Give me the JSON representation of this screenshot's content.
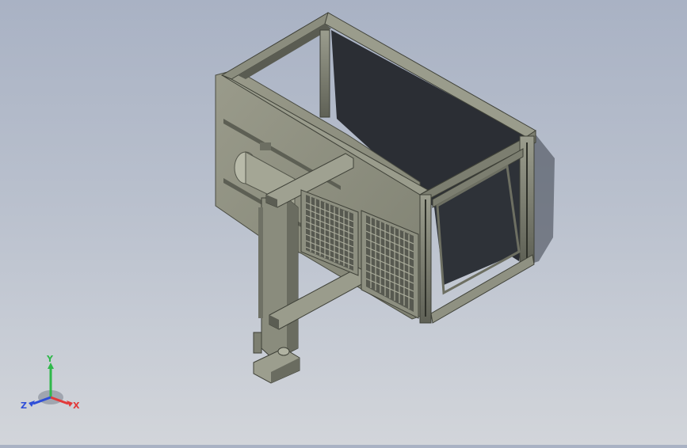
{
  "scene": {
    "title": "",
    "colors": {
      "background_top": "#a9b2c4",
      "background_bottom": "#d2d5da",
      "frame_metal": "#7b7d6f",
      "frame_dark": "#4c4e44",
      "panel": "#8d8f7f",
      "glass": "#2a2d33",
      "shadow": "#3f4450"
    }
  },
  "triad": {
    "x_label": "X",
    "y_label": "Y",
    "z_label": "Z",
    "x_color": "#e23a3a",
    "y_color": "#2fb84a",
    "z_color": "#2f4fd8"
  }
}
